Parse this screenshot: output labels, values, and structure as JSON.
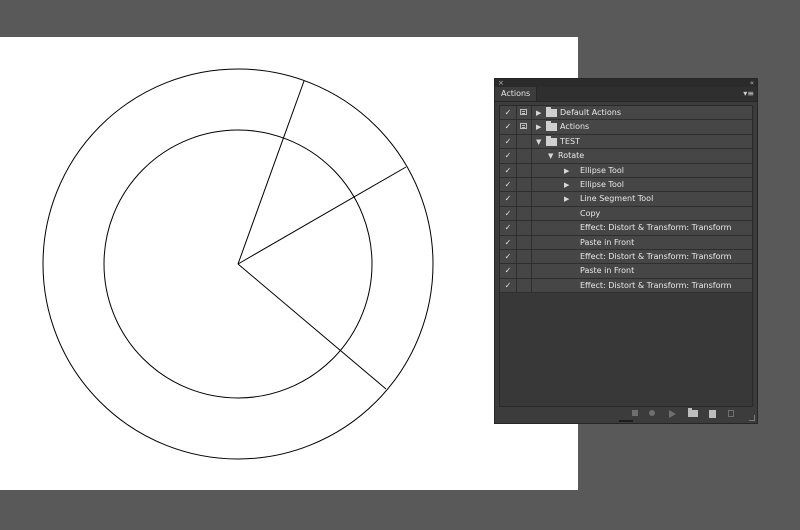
{
  "panel": {
    "close_symbol": "×",
    "collapse_symbol": "«",
    "tab_label": "Actions",
    "menu_symbol": "▾≡",
    "check": "✓",
    "expanded_marker": "▼",
    "collapsed_marker": "▶",
    "rows": [
      {
        "label": "Default Actions",
        "type": "set",
        "expanded": false,
        "dialog": true
      },
      {
        "label": "Actions",
        "type": "set",
        "expanded": false,
        "dialog": true
      },
      {
        "label": "TEST",
        "type": "set",
        "expanded": true,
        "dialog": false
      },
      {
        "label": "Rotate",
        "type": "action",
        "expanded": true,
        "dialog": false
      },
      {
        "label": "Ellipse Tool",
        "type": "command",
        "expandable": true
      },
      {
        "label": "Ellipse Tool",
        "type": "command",
        "expandable": true
      },
      {
        "label": "Line Segment Tool",
        "type": "command",
        "expandable": true
      },
      {
        "label": "Copy",
        "type": "command",
        "expandable": false
      },
      {
        "label": "Effect: Distort & Transform: Transform",
        "type": "command",
        "expandable": false
      },
      {
        "label": "Paste in Front",
        "type": "command",
        "expandable": false
      },
      {
        "label": "Effect: Distort & Transform: Transform",
        "type": "command",
        "expandable": false
      },
      {
        "label": "Paste in Front",
        "type": "command",
        "expandable": false
      },
      {
        "label": "Effect: Distort & Transform: Transform",
        "type": "command",
        "expandable": false
      }
    ],
    "footer_icons": [
      "stop-icon",
      "record-icon",
      "play-icon",
      "new-set-icon",
      "new-action-icon",
      "trash-icon"
    ]
  },
  "colors": {
    "canvas_bg": "#595959",
    "artboard": "#ffffff",
    "panel_bg": "#3c3c3c",
    "row_bg": "#464646"
  }
}
